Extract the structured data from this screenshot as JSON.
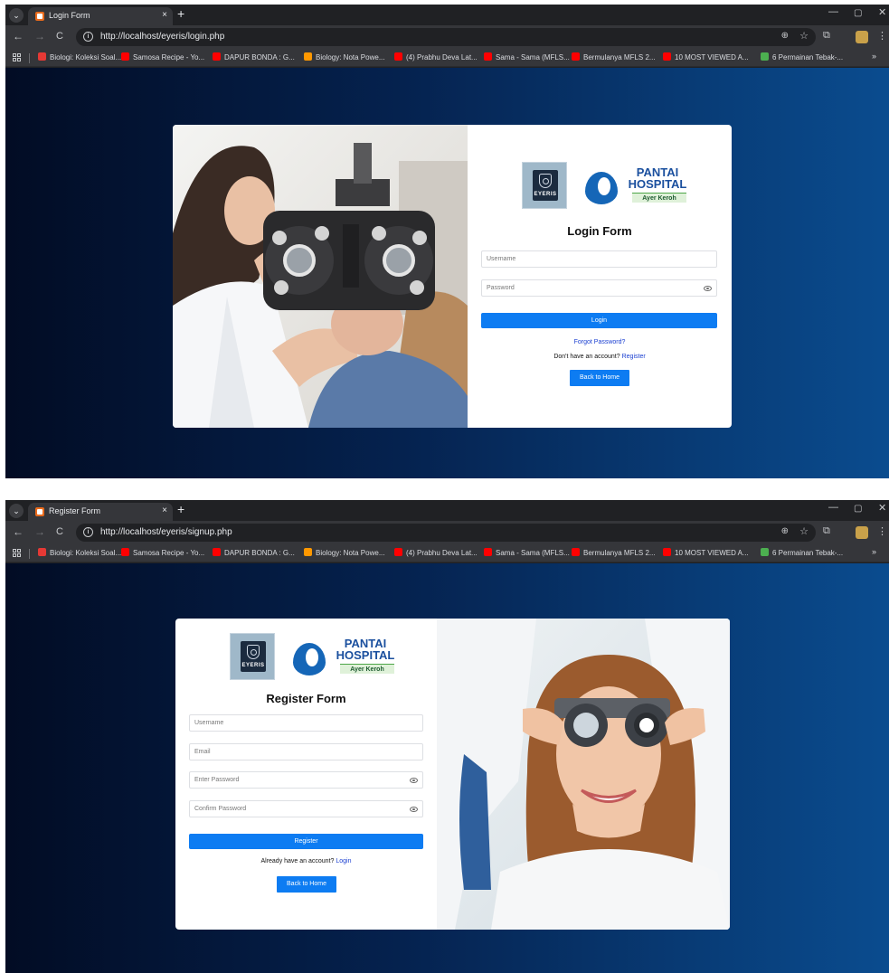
{
  "login_window": {
    "tab_title": "Login Form",
    "url": "http://localhost/eyeris/login.php",
    "logos": {
      "eyeris": "EYERIS",
      "pantai": "PANTAI HOSPITAL",
      "pantai_sub": "Ayer Keroh"
    },
    "form_title": "Login Form",
    "username_placeholder": "Username",
    "password_placeholder": "Password",
    "login_button": "Login",
    "forgot_password": "Forgot Password?",
    "register_prompt": "Don't have an account?",
    "register_link": "Register",
    "back_button": "Back to Home"
  },
  "register_window": {
    "tab_title": "Register Form",
    "url": "http://localhost/eyeris/signup.php",
    "logos": {
      "eyeris": "EYERIS",
      "pantai": "PANTAI HOSPITAL",
      "pantai_sub": "Ayer Keroh"
    },
    "form_title": "Register Form",
    "username_placeholder": "Username",
    "email_placeholder": "Email",
    "password_placeholder": "Enter Password",
    "confirm_placeholder": "Confirm Password",
    "register_button": "Register",
    "login_prompt": "Already have an account?",
    "login_link": "Login",
    "back_button": "Back to Home"
  },
  "bookmarks": [
    {
      "label": "Biologi: Koleksi Soal...",
      "icon": "red"
    },
    {
      "label": "Samosa Recipe - Yo...",
      "icon": "yt"
    },
    {
      "label": "DAPUR BONDA : G...",
      "icon": "yt"
    },
    {
      "label": "Biology: Nota Powe...",
      "icon": "orange"
    },
    {
      "label": "(4) Prabhu Deva Lat...",
      "icon": "yt"
    },
    {
      "label": "Sama - Sama (MFLS...",
      "icon": "yt"
    },
    {
      "label": "Bermulanya MFLS 2...",
      "icon": "yt"
    },
    {
      "label": "10 MOST VIEWED A...",
      "icon": "yt"
    },
    {
      "label": "6 Permainan Tebak-...",
      "icon": "green"
    }
  ],
  "bookmarks_more": "»",
  "icons": {
    "tab_close": "×",
    "new_tab": "+",
    "back": "←",
    "forward": "→",
    "reload": "C",
    "zoom": "⊕",
    "star": "☆",
    "minimize": "—",
    "maximize": "▢",
    "close": "✕"
  },
  "colors": {
    "primary_button": "#0d7cf2",
    "link": "#1a3fd1",
    "pantai_blue": "#1566b7"
  }
}
